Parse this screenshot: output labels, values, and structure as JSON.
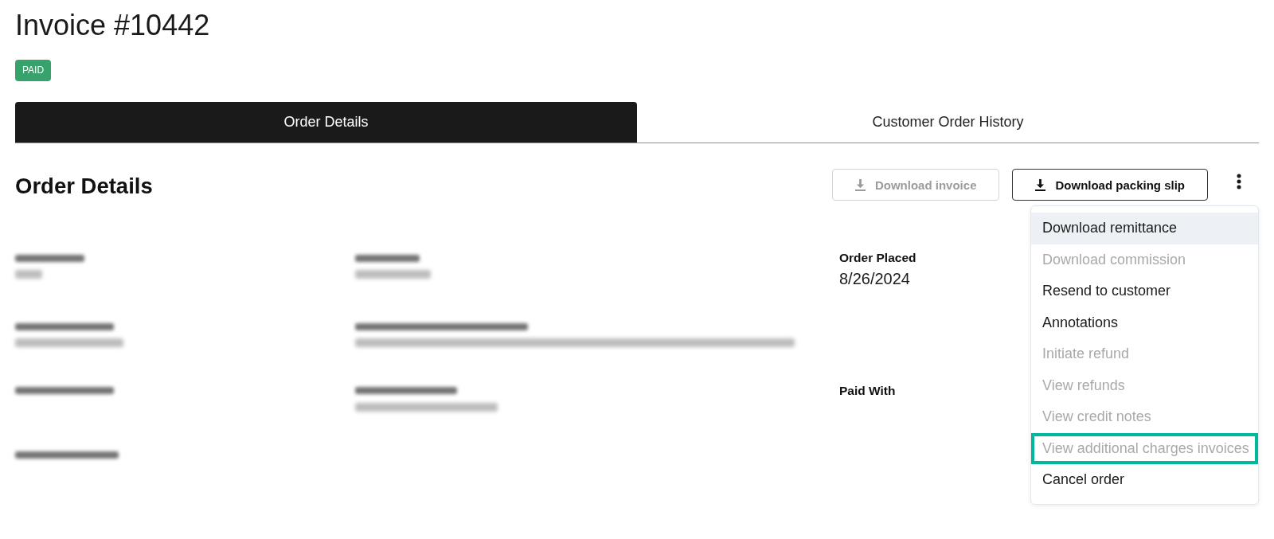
{
  "title": "Invoice #10442",
  "status_badge": "PAID",
  "tabs": [
    {
      "label": "Order Details",
      "selected": true
    },
    {
      "label": "Customer Order History",
      "selected": false
    }
  ],
  "section": {
    "heading": "Order Details",
    "buttons": [
      {
        "label": "Download invoice",
        "disabled": true
      },
      {
        "label": "Download packing slip",
        "disabled": false
      }
    ]
  },
  "details": [
    [
      {
        "kind": "redacted_pair"
      },
      {
        "kind": "redacted_pair"
      },
      {
        "kind": "field",
        "label": "Order Placed",
        "value": "8/26/2024"
      }
    ],
    [
      {
        "kind": "redacted_pair"
      },
      {
        "kind": "redacted_pair"
      }
    ],
    [
      {
        "kind": "redacted_label"
      },
      {
        "kind": "redacted_pair"
      },
      {
        "kind": "field",
        "label": "Paid With"
      }
    ],
    [
      {
        "kind": "redacted_label"
      }
    ]
  ],
  "menu": {
    "items": [
      {
        "label": "Download remittance",
        "disabled": false,
        "hovered": true,
        "highlighted": false
      },
      {
        "label": "Download commission",
        "disabled": true,
        "hovered": false,
        "highlighted": false
      },
      {
        "label": "Resend to customer",
        "disabled": false,
        "hovered": false,
        "highlighted": false
      },
      {
        "label": "Annotations",
        "disabled": false,
        "hovered": false,
        "highlighted": false
      },
      {
        "label": "Initiate refund",
        "disabled": true,
        "hovered": false,
        "highlighted": false
      },
      {
        "label": "View refunds",
        "disabled": true,
        "hovered": false,
        "highlighted": false
      },
      {
        "label": "View credit notes",
        "disabled": true,
        "hovered": false,
        "highlighted": false
      },
      {
        "label": "View additional charges invoices",
        "disabled": true,
        "hovered": false,
        "highlighted": true
      },
      {
        "label": "Cancel order",
        "disabled": false,
        "hovered": false,
        "highlighted": false
      }
    ]
  }
}
